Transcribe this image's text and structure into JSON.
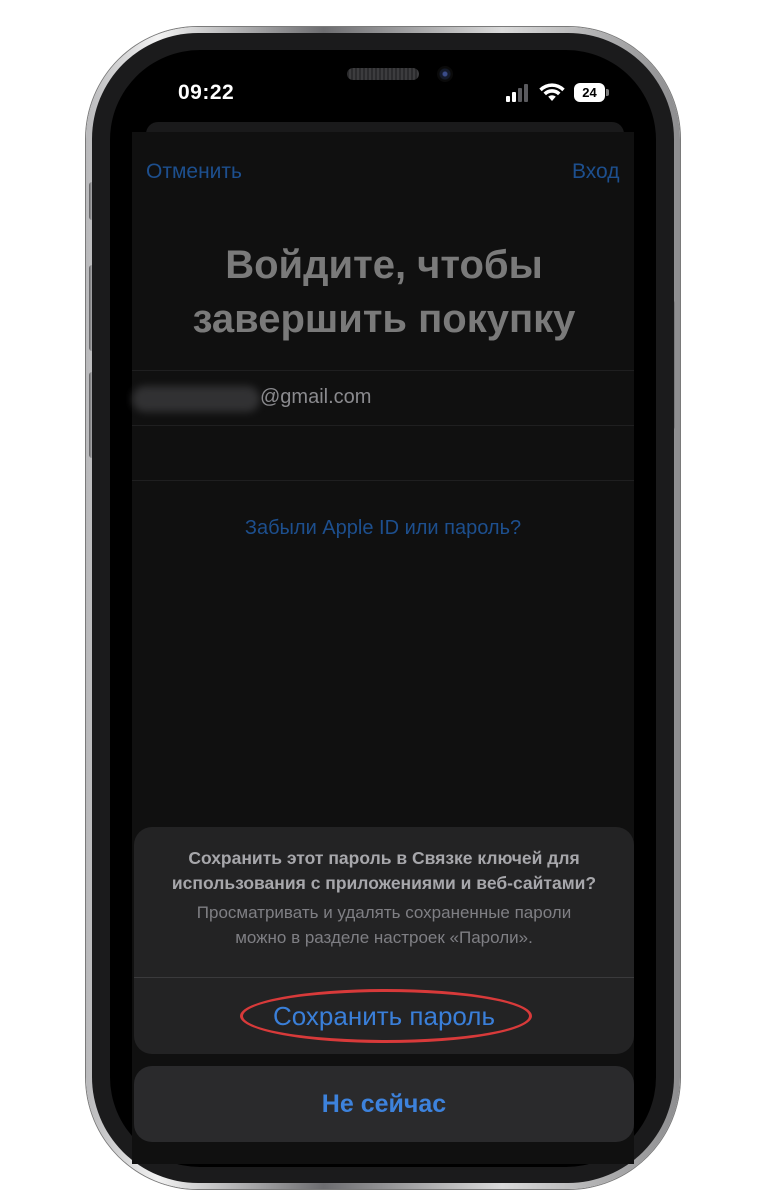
{
  "status_bar": {
    "time": "09:22",
    "battery_level": "24"
  },
  "nav": {
    "cancel_label": "Отменить",
    "login_label": "Вход"
  },
  "signin": {
    "title_line1": "Войдите, чтобы",
    "title_line2": "завершить покупку",
    "email_domain": "@gmail.com",
    "forgot_link": "Забыли Apple ID или пароль?"
  },
  "action_sheet": {
    "title_line1": "Сохранить этот пароль в Связке ключей для",
    "title_line2": "использования с приложениями и веб-сайтами?",
    "message_line1": "Просматривать и удалять сохраненные пароли",
    "message_line2": "можно в разделе настроек «Пароли».",
    "save_button": "Сохранить пароль",
    "not_now_button": "Не сейчас"
  },
  "colors": {
    "link_blue": "#3a7fd9",
    "annotation_red": "#d83a3a"
  }
}
